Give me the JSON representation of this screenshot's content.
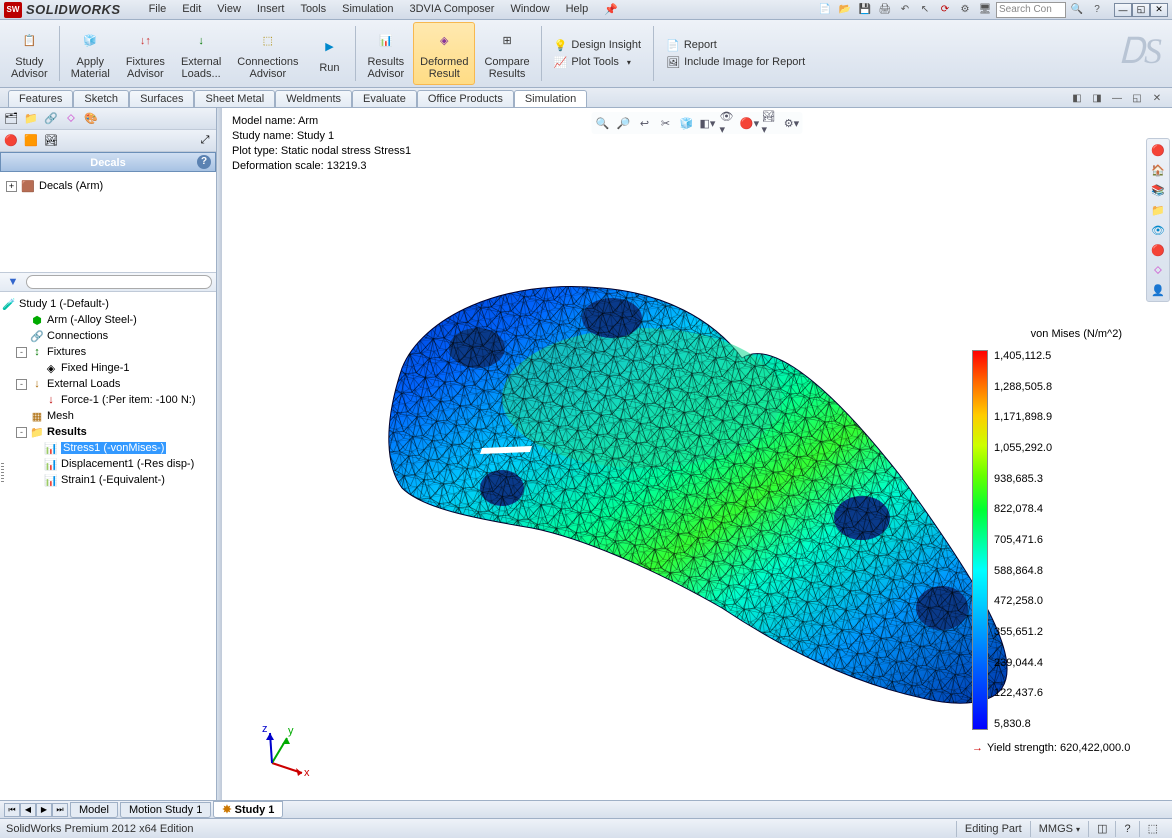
{
  "app": {
    "title": "SOLIDWORKS"
  },
  "menu": [
    "File",
    "Edit",
    "View",
    "Insert",
    "Tools",
    "Simulation",
    "3DVIA Composer",
    "Window",
    "Help"
  ],
  "search_placeholder": "Search Con",
  "ribbon": {
    "buttons": [
      {
        "label": "Study\nAdvisor"
      },
      {
        "label": "Apply\nMaterial"
      },
      {
        "label": "Fixtures\nAdvisor"
      },
      {
        "label": "External\nLoads..."
      },
      {
        "label": "Connections\nAdvisor"
      },
      {
        "label": "Run"
      },
      {
        "label": "Results\nAdvisor"
      },
      {
        "label": "Deformed\nResult"
      },
      {
        "label": "Compare\nResults"
      }
    ],
    "stack1": [
      "Design Insight",
      "Plot Tools"
    ],
    "stack2": [
      "Report",
      "Include Image for Report"
    ]
  },
  "tabs": [
    "Features",
    "Sketch",
    "Surfaces",
    "Sheet Metal",
    "Weldments",
    "Evaluate",
    "Office Products",
    "Simulation"
  ],
  "active_tab": "Simulation",
  "decals": {
    "header": "Decals",
    "item": "Decals (Arm)"
  },
  "study_tree": {
    "root": "Study 1 (-Default-)",
    "arm": "Arm (-Alloy Steel-)",
    "connections": "Connections",
    "fixtures": "Fixtures",
    "fixed": "Fixed Hinge-1",
    "loads": "External Loads",
    "force": "Force-1 (:Per item: -100 N:)",
    "mesh": "Mesh",
    "results": "Results",
    "stress": "Stress1 (-vonMises-)",
    "disp": "Displacement1 (-Res disp-)",
    "strain": "Strain1 (-Equivalent-)"
  },
  "model_info": {
    "l1": "Model name: Arm",
    "l2": "Study name: Study 1",
    "l3": "Plot type: Static nodal stress Stress1",
    "l4": "Deformation scale: 13219.3"
  },
  "legend": {
    "title": "von Mises (N/m^2)",
    "values": [
      "1,405,112.5",
      "1,288,505.8",
      "1,171,898.9",
      "1,055,292.0",
      "938,685.3",
      "822,078.4",
      "705,471.6",
      "588,864.8",
      "472,258.0",
      "355,651.2",
      "239,044.4",
      "122,437.6",
      "5,830.8"
    ],
    "yield": "Yield strength: 620,422,000.0"
  },
  "bottom_tabs": [
    "Model",
    "Motion Study 1",
    "Study 1"
  ],
  "active_bottom": "Study 1",
  "status": {
    "left": "SolidWorks Premium 2012 x64 Edition",
    "editing": "Editing Part",
    "units": "MMGS"
  }
}
